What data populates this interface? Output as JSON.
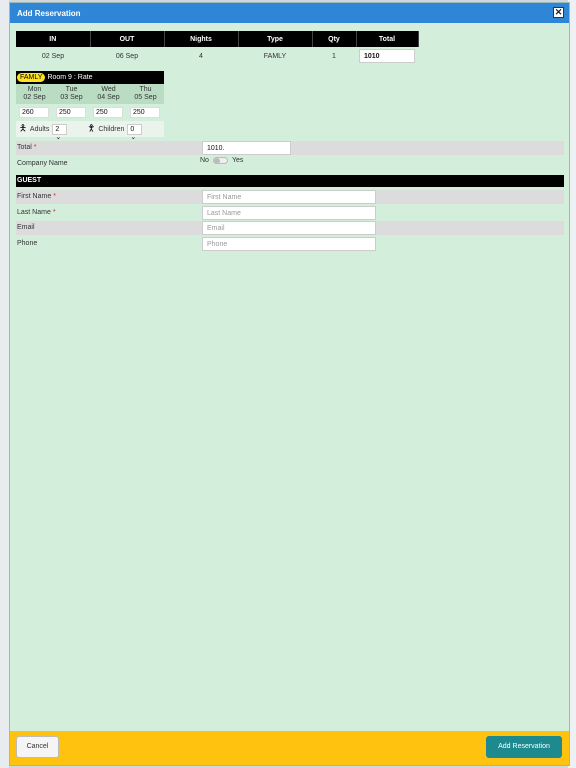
{
  "dialog": {
    "title": "Add Reservation"
  },
  "summary": {
    "headers": [
      "IN",
      "OUT",
      "Nights",
      "Type",
      "Qty",
      "Total"
    ],
    "row": {
      "in": "02 Sep",
      "out": "06 Sep",
      "nights": "4",
      "type": "FAMLY",
      "qty": "1",
      "total": "1010"
    }
  },
  "rate": {
    "room_type": "FAMLY",
    "room_label": "Room 9 : Rate",
    "days": [
      {
        "dow": "Mon",
        "date": "02 Sep",
        "rate": "260"
      },
      {
        "dow": "Tue",
        "date": "03 Sep",
        "rate": "250"
      },
      {
        "dow": "Wed",
        "date": "04 Sep",
        "rate": "250"
      },
      {
        "dow": "Thu",
        "date": "05 Sep",
        "rate": "250"
      }
    ],
    "adults_label": "Adults",
    "adults_value": "2",
    "children_label": "Children",
    "children_value": "0"
  },
  "booking": {
    "total_label": "Total",
    "total_value": "1010.",
    "company_label": "Company Name",
    "toggle_no": "No",
    "toggle_yes": "Yes"
  },
  "guest": {
    "section_title": "GUEST",
    "first_name_label": "First Name",
    "first_name_placeholder": "First Name",
    "last_name_label": "Last Name",
    "last_name_placeholder": "Last Name",
    "email_label": "Email",
    "email_placeholder": "Email",
    "phone_label": "Phone",
    "phone_placeholder": "Phone",
    "required_mark": "*"
  },
  "footer": {
    "cancel_label": "Cancel",
    "submit_label": "Add Reservation"
  },
  "colors": {
    "header": "#2f86d6",
    "body": "#d3eedb",
    "footer": "#ffc20e",
    "submit": "#1d8a8f",
    "badge": "#ffe21f"
  },
  "icons": [
    "close-icon",
    "adult-person-icon",
    "child-person-icon",
    "chevron-down-icon"
  ]
}
